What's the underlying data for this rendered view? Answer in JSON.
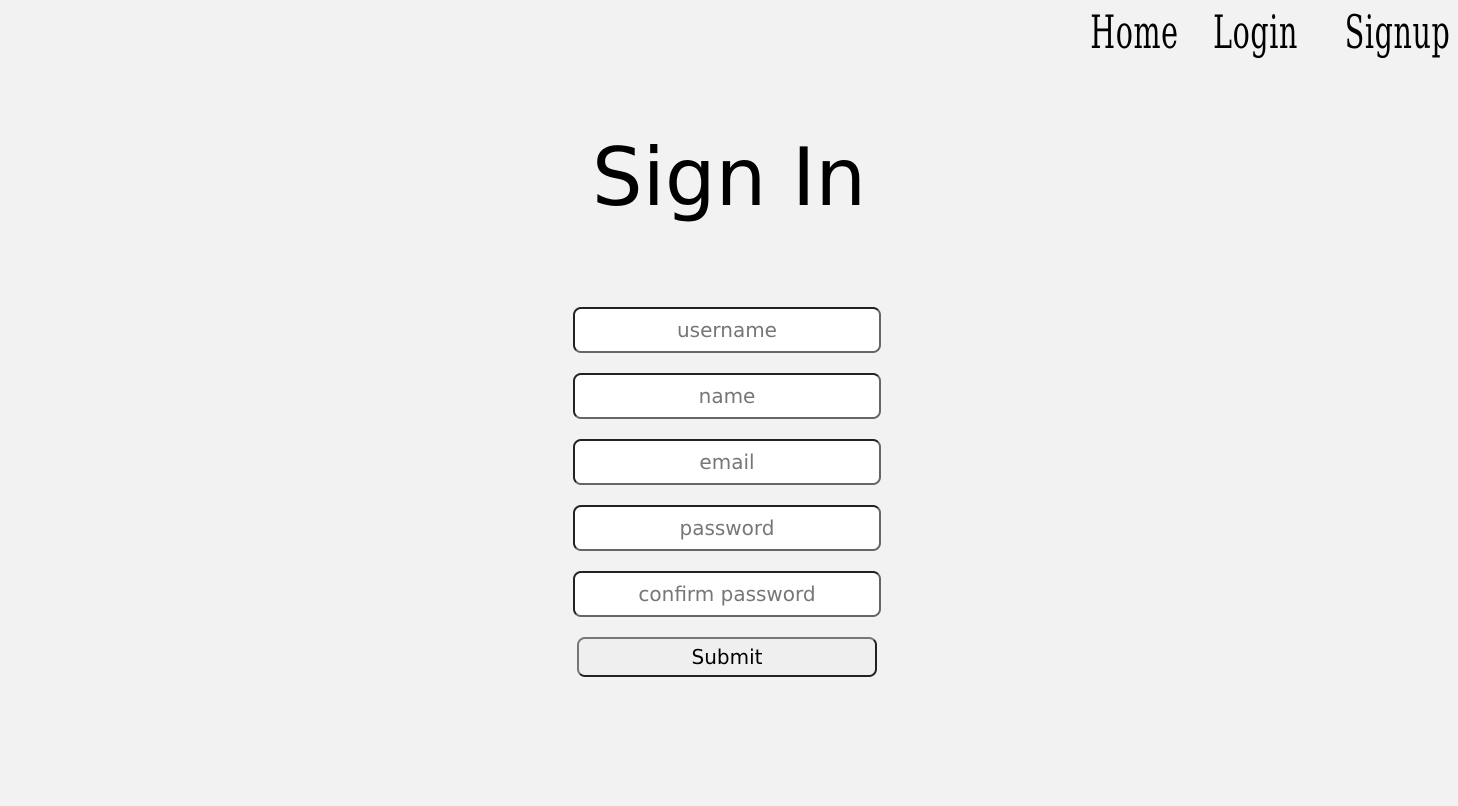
{
  "nav": {
    "items": [
      {
        "label": "Home"
      },
      {
        "label": "Login"
      },
      {
        "label": "Signup"
      }
    ]
  },
  "page": {
    "title": "Sign In"
  },
  "form": {
    "fields": [
      {
        "placeholder": "username",
        "value": ""
      },
      {
        "placeholder": "name",
        "value": ""
      },
      {
        "placeholder": "email",
        "value": ""
      },
      {
        "placeholder": "password",
        "value": ""
      },
      {
        "placeholder": "confirm password",
        "value": ""
      }
    ],
    "submit_label": "Submit"
  }
}
